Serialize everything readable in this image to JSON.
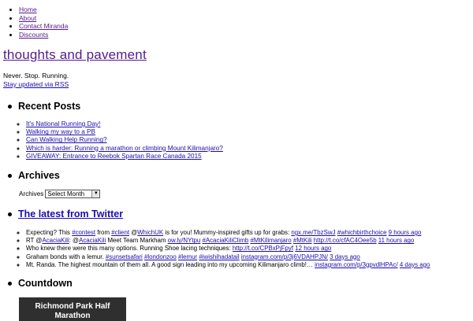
{
  "nav": {
    "items": [
      "Home",
      "About",
      "Contact Miranda",
      "Discounts"
    ]
  },
  "site": {
    "title": "thoughts and pavement",
    "tagline": "Never. Stop. Running.",
    "rss_label": "Stay updated via RSS"
  },
  "recent_posts": {
    "heading": "Recent Posts",
    "items": [
      "It's National Running Day!",
      "Walking my way to a PB",
      "Can Walking Help Running?",
      "Which is harder: Running a marathon or climbing Mount Kilimanjaro?",
      "GIVEAWAY: Entrance to Reebok Spartan Race Canada 2015"
    ]
  },
  "archives": {
    "heading": "Archives",
    "label": "Archives",
    "select_value": "Select Month"
  },
  "twitter": {
    "heading": "The latest from Twitter",
    "tweets": [
      {
        "parts": [
          {
            "t": "Expecting? This ",
            "link": false
          },
          {
            "t": "#contest",
            "link": true
          },
          {
            "t": " from ",
            "link": false
          },
          {
            "t": "#client",
            "link": true
          },
          {
            "t": " @",
            "link": false
          },
          {
            "t": "WhichUK",
            "link": true
          },
          {
            "t": " is for you! Mummy-inspired gifts up for grabs: ",
            "link": false
          },
          {
            "t": "ngx.me/TbzSwJ",
            "link": true
          },
          {
            "t": " ",
            "link": false
          },
          {
            "t": "#whichbirthchoice",
            "link": true
          },
          {
            "t": " ",
            "link": false
          },
          {
            "t": "9 hours ago",
            "link": true
          }
        ]
      },
      {
        "parts": [
          {
            "t": "RT @",
            "link": false
          },
          {
            "t": "AcaciaKili",
            "link": true
          },
          {
            "t": ": @",
            "link": false
          },
          {
            "t": "AcaciaKili",
            "link": true
          },
          {
            "t": " Meet Team Markham ",
            "link": false
          },
          {
            "t": "ow.ly/NYtpu",
            "link": true
          },
          {
            "t": " ",
            "link": false
          },
          {
            "t": "#AcaciaKiliClimb",
            "link": true
          },
          {
            "t": " ",
            "link": false
          },
          {
            "t": "#MtKilimanjaro",
            "link": true
          },
          {
            "t": " ",
            "link": false
          },
          {
            "t": "#MtKili",
            "link": true
          },
          {
            "t": " ",
            "link": false
          },
          {
            "t": "http://t.co/cfAC4Oee5b",
            "link": true
          },
          {
            "t": " ",
            "link": false
          },
          {
            "t": "11 hours ago",
            "link": true
          }
        ]
      },
      {
        "parts": [
          {
            "t": "Who knew there were this many options. Running Shoe lacing techniques: ",
            "link": false
          },
          {
            "t": "http://t.co/CPBxPjFpyf",
            "link": true
          },
          {
            "t": " ",
            "link": false
          },
          {
            "t": "12 hours ago",
            "link": true
          }
        ]
      },
      {
        "parts": [
          {
            "t": "Graham bonds with a lemur. ",
            "link": false
          },
          {
            "t": "#sunsetsafari",
            "link": true
          },
          {
            "t": " ",
            "link": false
          },
          {
            "t": "#londonzoo",
            "link": true
          },
          {
            "t": " ",
            "link": false
          },
          {
            "t": "#lemur",
            "link": true
          },
          {
            "t": " ",
            "link": false
          },
          {
            "t": "#iwishihadatail",
            "link": true
          },
          {
            "t": " ",
            "link": false
          },
          {
            "t": "instagram.com/p/3j6VDAHPJN/",
            "link": true
          },
          {
            "t": " ",
            "link": false
          },
          {
            "t": "3 days ago",
            "link": true
          }
        ]
      },
      {
        "parts": [
          {
            "t": "Mt. Randa. The highest mountain of them all. A good sign leading into my upcoming Kilimanjaro climb!… ",
            "link": false
          },
          {
            "t": "instagram.com/p/3gpvdlHPAc/",
            "link": true
          },
          {
            "t": " ",
            "link": false
          },
          {
            "t": "4 days ago",
            "link": true
          }
        ]
      }
    ]
  },
  "countdown": {
    "heading": "Countdown",
    "box_text": "Richmond Park Half Marathon"
  }
}
